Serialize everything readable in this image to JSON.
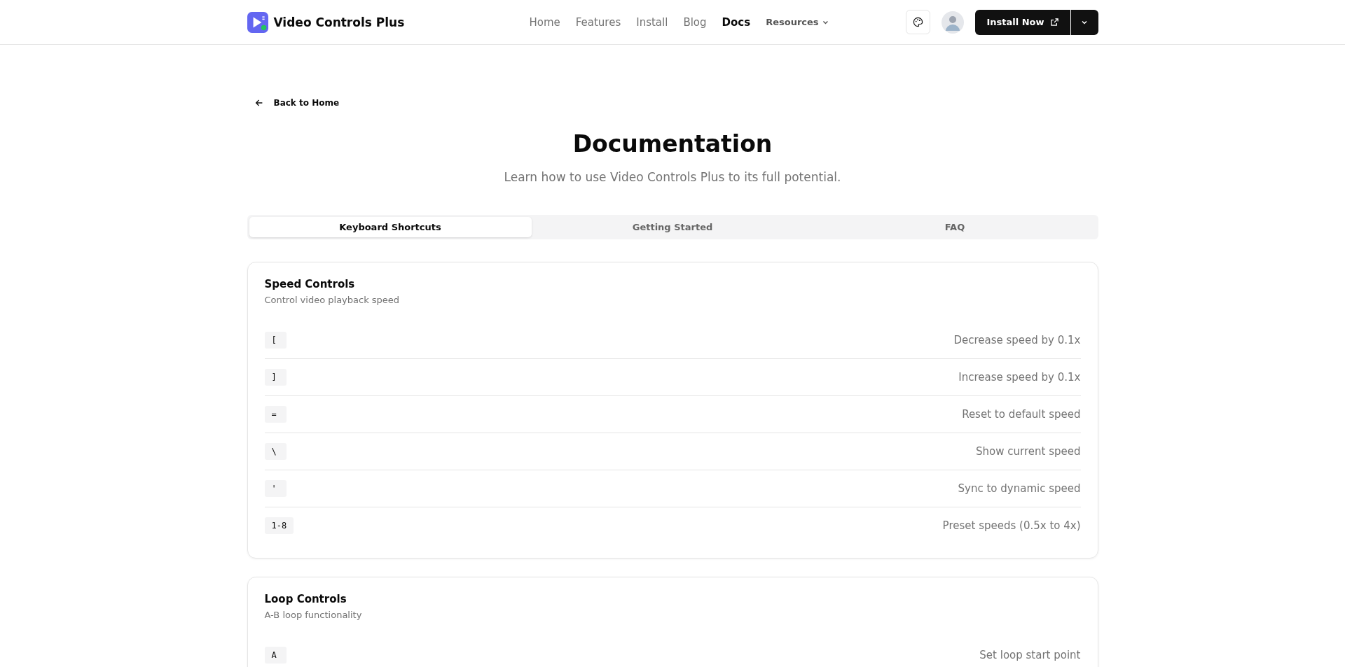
{
  "brand": {
    "name": "Video Controls Plus"
  },
  "nav": [
    {
      "label": "Home",
      "selected": false
    },
    {
      "label": "Features",
      "selected": false
    },
    {
      "label": "Install",
      "selected": false
    },
    {
      "label": "Blog",
      "selected": false
    },
    {
      "label": "Docs",
      "selected": true
    },
    {
      "label": "Resources",
      "selected": false,
      "kind": "dropdown"
    }
  ],
  "install_button": {
    "label": "Install Now"
  },
  "back_link": "Back to Home",
  "title": "Documentation",
  "subtitle": "Learn how to use Video Controls Plus to its full potential.",
  "tabs": [
    {
      "label": "Keyboard Shortcuts",
      "selected": true
    },
    {
      "label": "Getting Started",
      "selected": false
    },
    {
      "label": "FAQ",
      "selected": false
    }
  ],
  "sections": [
    {
      "title": "Speed Controls",
      "description": "Control video playback speed",
      "shortcuts": [
        {
          "key": "[",
          "action": "Decrease speed by 0.1x"
        },
        {
          "key": "]",
          "action": "Increase speed by 0.1x"
        },
        {
          "key": "=",
          "action": "Reset to default speed"
        },
        {
          "key": "\\",
          "action": "Show current speed"
        },
        {
          "key": "'",
          "action": "Sync to dynamic speed"
        },
        {
          "key": "1-8",
          "action": "Preset speeds (0.5x to 4x)"
        }
      ]
    },
    {
      "title": "Loop Controls",
      "description": "A-B loop functionality",
      "shortcuts": [
        {
          "key": "A",
          "action": "Set loop start point"
        }
      ]
    }
  ]
}
